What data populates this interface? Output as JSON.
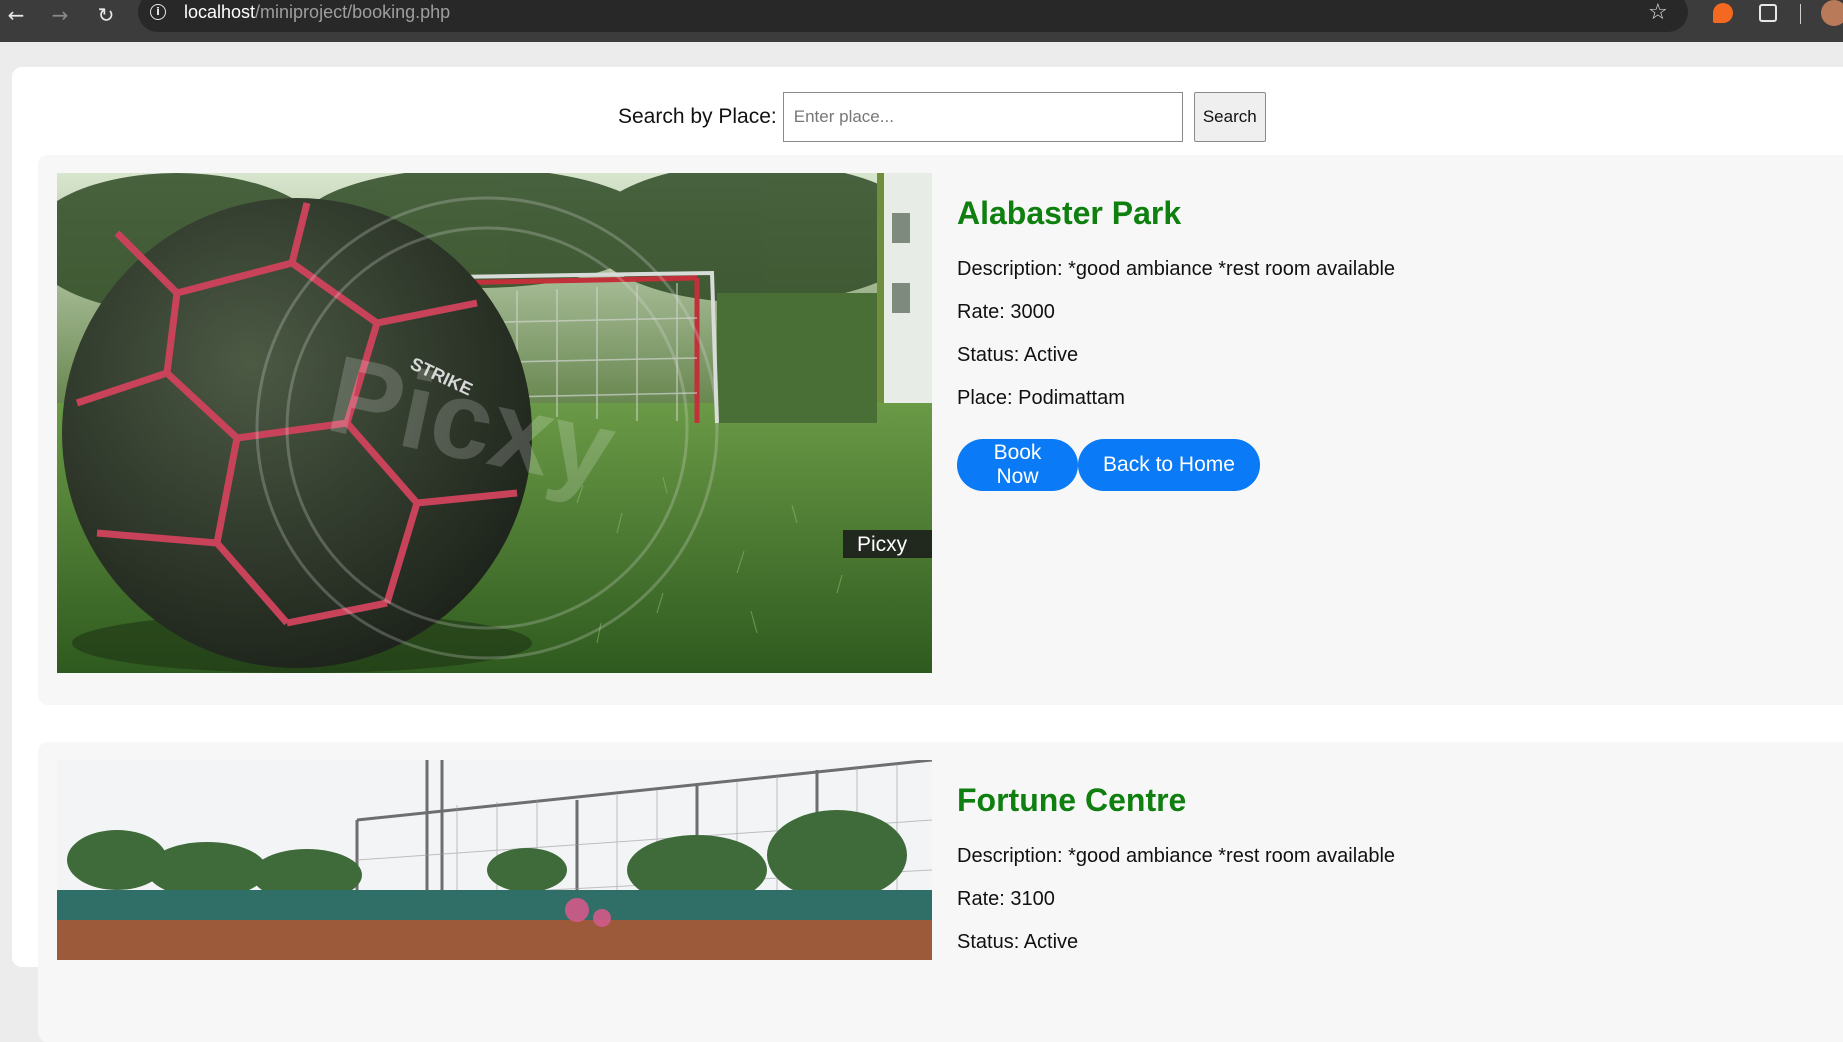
{
  "browser": {
    "url_host": "localhost",
    "url_path": "/miniproject/booking.php"
  },
  "search": {
    "label": "Search by Place:",
    "placeholder": "Enter place...",
    "button_label": "Search"
  },
  "venues": [
    {
      "name": "Alabaster Park",
      "description": "Description: *good ambiance *rest room available",
      "rate": "Rate: 3000",
      "status": "Status: Active",
      "place": "Place: Podimattam",
      "photo_watermark": "Picxy",
      "book_label": "Book Now",
      "home_label": "Back to Home"
    },
    {
      "name": "Fortune Centre",
      "description": "Description: *good ambiance *rest room available",
      "rate": "Rate: 3100",
      "status": "Status: Active"
    }
  ],
  "colors": {
    "title_green": "#0f7f0f",
    "button_blue": "#0a7af6"
  }
}
